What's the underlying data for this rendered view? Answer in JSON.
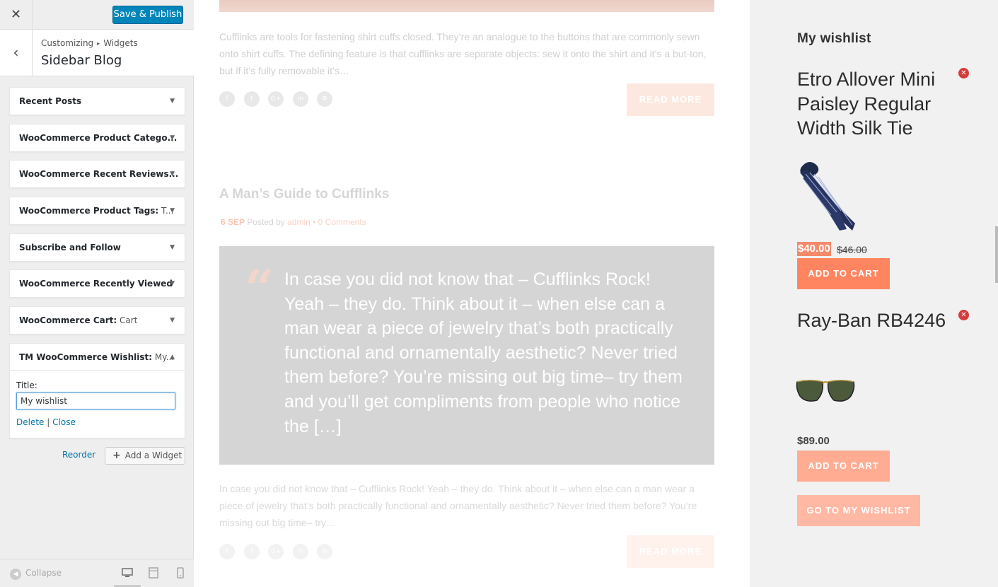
{
  "customizer": {
    "close_icon": "close-icon",
    "publish_label": "Save & Publish",
    "back_icon": "chevron-left-icon",
    "breadcrumb": [
      "Customizing",
      "Widgets"
    ],
    "panel_title": "Sidebar Blog",
    "widgets": [
      {
        "title": "Recent Posts",
        "sub": ""
      },
      {
        "title": "WooCommerce Product Catego...",
        "sub": ""
      },
      {
        "title": "WooCommerce Recent Reviews...",
        "sub": ""
      },
      {
        "title": "WooCommerce Product Tags:",
        "sub": " T..."
      },
      {
        "title": "Subscribe and Follow",
        "sub": ""
      },
      {
        "title": "WooCommerce Recently Viewed",
        "sub": ""
      },
      {
        "title": "WooCommerce Cart:",
        "sub": " Cart"
      },
      {
        "title": "TM WooCommerce Wishlist:",
        "sub": " My..."
      }
    ],
    "open_widget": {
      "title_label": "Title:",
      "title_value": "My wishlist",
      "delete_label": "Delete",
      "separator": "|",
      "close_label": "Close"
    },
    "reorder_label": "Reorder",
    "add_widget_label": "Add a Widget",
    "collapse_label": "Collapse",
    "devices": [
      "desktop-icon",
      "tablet-icon",
      "mobile-icon"
    ]
  },
  "preview": {
    "excerpt1": "Cufflinks are tools for fastening shirt cuffs closed. They’re an analogue to the buttons that are commonly sewn onto shirt cuffs. The defining feature is that cufflinks are separate objects: sew it onto the shirt and it’s a but-ton, but if it’s fully removable it’s…",
    "read_more": "READ MORE",
    "social_icons": [
      "f",
      "t",
      "G+",
      "in",
      "⚙"
    ],
    "post_title": "A Man’s Guide to Cufflinks",
    "meta": {
      "date": "6 SEP",
      "posted_by": "Posted by",
      "author": "admin",
      "dot": "•",
      "comments": "0 Comments"
    },
    "quote_mark": "“",
    "quote": "In case you did not know that  – Cufflinks Rock! Yeah – they do. Think about it – when else can a man wear a piece of jewelry that’s both practically functional and ornamentally aesthetic? Never tried them before? You’re missing out big time– try them and you’ll get compliments from people who notice the […]",
    "excerpt2": "In case you did not know that  – Cufflinks Rock! Yeah – they do. Think about it – when else can a man wear a piece of jewelry that’s both practically functional and ornamentally aesthetic? Never tried them before? You’re missing out big time– try…"
  },
  "wishlist": {
    "title": "My wishlist",
    "items": [
      {
        "name": "Etro Allover Mini Paisley Regular Width Silk Tie",
        "price_sale": "$40.00",
        "price_old": "$46.00",
        "cta": "ADD TO CART"
      },
      {
        "name": "Ray-Ban RB4246",
        "price": "$89.00",
        "cta": "ADD TO CART"
      }
    ],
    "remove_glyph": "✕",
    "go_label": "GO TO MY WISHLIST"
  }
}
